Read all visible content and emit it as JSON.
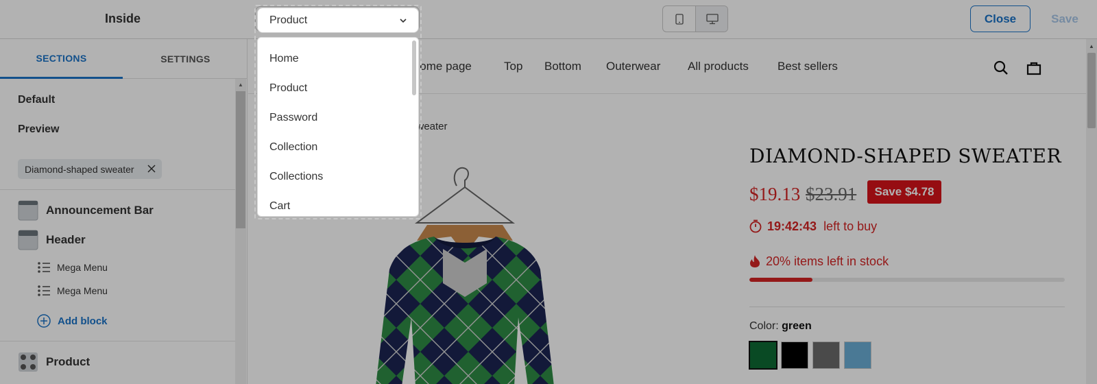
{
  "app": {
    "title": "Inside"
  },
  "page_select": {
    "value": "Product"
  },
  "toolbar": {
    "close_label": "Close",
    "save_label": "Save"
  },
  "sidebar": {
    "tabs": [
      {
        "label": "SECTIONS"
      },
      {
        "label": "SETTINGS"
      }
    ],
    "default_label": "Default",
    "preview_label": "Preview",
    "preview_chip": "Diamond-shaped sweater",
    "sections": [
      {
        "name": "Announcement Bar"
      },
      {
        "name": "Header"
      },
      {
        "name": "Product"
      }
    ],
    "header_blocks": [
      {
        "label": "Mega Menu"
      },
      {
        "label": "Mega Menu"
      }
    ],
    "add_block_label": "Add block"
  },
  "dropdown": {
    "options": [
      {
        "label": "Home"
      },
      {
        "label": "Product"
      },
      {
        "label": "Password"
      },
      {
        "label": "Collection"
      },
      {
        "label": "Collections"
      },
      {
        "label": "Cart"
      }
    ]
  },
  "preview": {
    "nav": [
      {
        "label": "Home page"
      },
      {
        "label": "Top"
      },
      {
        "label": "Bottom"
      },
      {
        "label": "Outerwear"
      },
      {
        "label": "All products"
      },
      {
        "label": "Best sellers"
      }
    ],
    "breadcrumb_tail": "sweater",
    "product": {
      "title": "DIAMOND-SHAPED SWEATER",
      "price": "$19.13",
      "compare_price": "$23.91",
      "save_badge": "Save $4.78",
      "countdown": "19:42:43",
      "countdown_suffix": "left to buy",
      "stock_text": "20% items left in stock",
      "stock_fraction": 0.2,
      "color_label": "Color:",
      "color_value": "green",
      "swatches": [
        {
          "name": "green",
          "hex": "#0d6b34"
        },
        {
          "name": "black",
          "hex": "#000000"
        },
        {
          "name": "gray",
          "hex": "#6b6b6b"
        },
        {
          "name": "blue",
          "hex": "#6aaed6"
        }
      ]
    }
  },
  "colors": {
    "accent": "#1a73c8",
    "sale": "#d42525",
    "badge": "#d7141a"
  }
}
